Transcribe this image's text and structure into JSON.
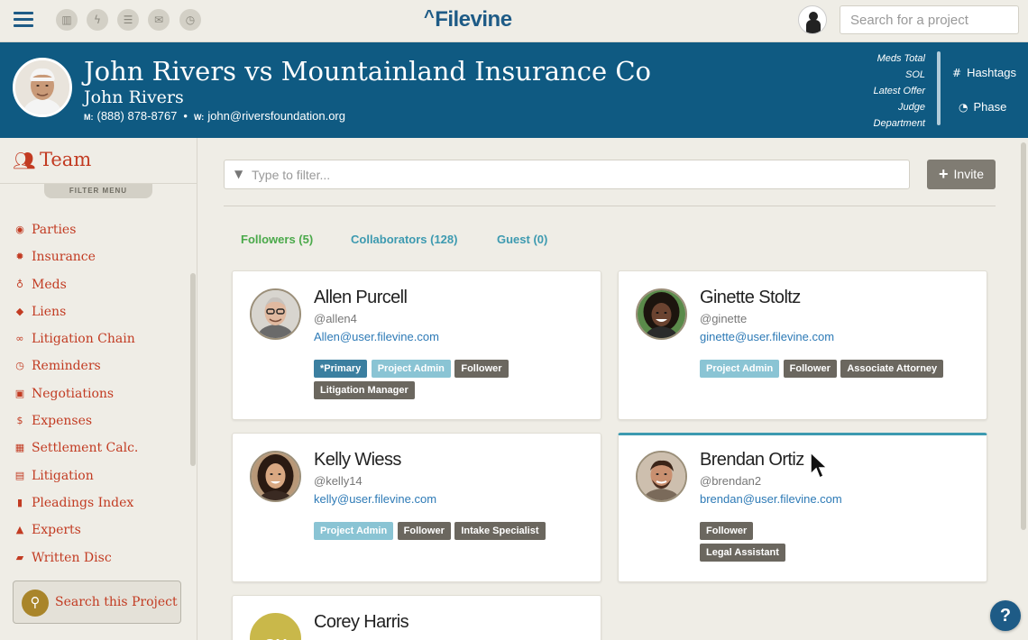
{
  "topbar": {
    "logo": "Filevine",
    "search_placeholder": "Search for a project",
    "icons": [
      "layout-icon",
      "bolt-icon",
      "list-icon",
      "mail-icon",
      "clock-icon"
    ]
  },
  "project": {
    "title": "John Rivers vs Mountainland Insurance Co",
    "client": "John Rivers",
    "mobile_label": "M:",
    "mobile": "(888) 878-8767",
    "separator": "•",
    "work_label": "W:",
    "work_email": "john@riversfoundation.org",
    "meta_fields": [
      "Meds Total",
      "SOL",
      "Latest Offer",
      "Judge",
      "Department"
    ],
    "hashtags_label": "Hashtags",
    "phase_label": "Phase"
  },
  "sidebar": {
    "section_title": "Team",
    "filter_menu_label": "FILTER MENU",
    "items": [
      {
        "label": "Parties",
        "icon": "user-circle-icon",
        "glyph": "◉"
      },
      {
        "label": "Insurance",
        "icon": "asterisk-icon",
        "glyph": "✹"
      },
      {
        "label": "Meds",
        "icon": "stethoscope-icon",
        "glyph": "♁"
      },
      {
        "label": "Liens",
        "icon": "tags-icon",
        "glyph": "◆"
      },
      {
        "label": "Litigation Chain",
        "icon": "link-icon",
        "glyph": "∞"
      },
      {
        "label": "Reminders",
        "icon": "clock-icon",
        "glyph": "◷"
      },
      {
        "label": "Negotiations",
        "icon": "money-icon",
        "glyph": "▣"
      },
      {
        "label": "Expenses",
        "icon": "dollar-icon",
        "glyph": "$"
      },
      {
        "label": "Settlement Calc.",
        "icon": "calculator-icon",
        "glyph": "▦"
      },
      {
        "label": "Litigation",
        "icon": "document-icon",
        "glyph": "▤"
      },
      {
        "label": "Pleadings Index",
        "icon": "file-icon",
        "glyph": "▮"
      },
      {
        "label": "Experts",
        "icon": "graduation-cap-icon",
        "glyph": "▲"
      },
      {
        "label": "Written Disc",
        "icon": "book-icon",
        "glyph": "▰"
      }
    ],
    "search_project_label": "Search this Project"
  },
  "main": {
    "filter_placeholder": "Type to filter...",
    "invite_label": "Invite",
    "tabs": [
      {
        "label": "Followers (5)",
        "active": true
      },
      {
        "label": "Collaborators (128)",
        "active": false
      },
      {
        "label": "Guest (0)",
        "active": false
      }
    ],
    "cards": [
      {
        "name": "Allen Purcell",
        "handle": "@allen4",
        "email": "Allen@user.filevine.com",
        "badges": [
          {
            "label": "*Primary",
            "kind": "primary"
          },
          {
            "label": "Project Admin",
            "kind": "admin"
          },
          {
            "label": "Follower",
            "kind": "role"
          },
          {
            "label": "Litigation Manager",
            "kind": "role"
          }
        ]
      },
      {
        "name": "Ginette Stoltz",
        "handle": "@ginette",
        "email": "ginette@user.filevine.com",
        "badges": [
          {
            "label": "Project Admin",
            "kind": "admin"
          },
          {
            "label": "Follower",
            "kind": "role"
          },
          {
            "label": "Associate Attorney",
            "kind": "role"
          }
        ]
      },
      {
        "name": "Kelly Wiess",
        "handle": "@kelly14",
        "email": "kelly@user.filevine.com",
        "badges": [
          {
            "label": "Project Admin",
            "kind": "admin"
          },
          {
            "label": "Follower",
            "kind": "role"
          },
          {
            "label": "Intake Specialist",
            "kind": "role"
          }
        ]
      },
      {
        "name": "Brendan Ortiz",
        "handle": "@brendan2",
        "email": "brendan@user.filevine.com",
        "badges": [
          {
            "label": "Follower",
            "kind": "role"
          },
          {
            "label": "Legal Assistant",
            "kind": "role"
          }
        ]
      },
      {
        "name": "Corey Harris",
        "initials": "CH"
      }
    ]
  },
  "help_label": "?",
  "colors": {
    "brand_blue": "#1e5b86",
    "header_blue": "#0f5a82",
    "sidebar_red": "#c23b22",
    "tab_active": "#4aa94a",
    "tab_link": "#3d9ab0"
  }
}
